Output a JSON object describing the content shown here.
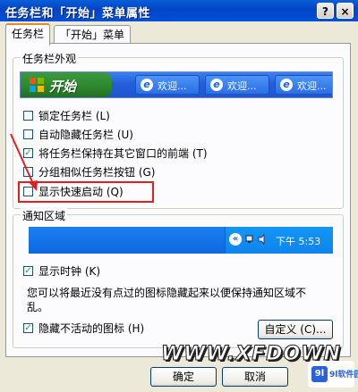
{
  "window": {
    "title": "任务栏和「开始」菜单属性",
    "help_label": "?",
    "close_label": "×"
  },
  "tabs": [
    {
      "label": "任务栏"
    },
    {
      "label": "「开始」菜单"
    }
  ],
  "appearance": {
    "group_label": "任务栏外观",
    "preview": {
      "start_label": "开始",
      "buttons": [
        {
          "label": "欢迎..."
        },
        {
          "label": "欢迎..."
        },
        {
          "label": "欢迎..."
        }
      ]
    },
    "options": [
      {
        "label": "锁定任务栏 (L)",
        "checked": false
      },
      {
        "label": "自动隐藏任务栏 (U)",
        "checked": false
      },
      {
        "label": "将任务栏保持在其它窗口的前端 (T)",
        "checked": true
      },
      {
        "label": "分组相似任务栏按钮 (G)",
        "checked": false
      },
      {
        "label": "显示快速启动 (Q)",
        "checked": false
      }
    ],
    "check_mark": "✓"
  },
  "notification": {
    "group_label": "通知区域",
    "tray_chevron": "«",
    "clock": "下午 5:53",
    "show_clock": {
      "label": "显示时钟 (K)",
      "checked": true
    },
    "description": "您可以将最近没有点过的图标隐藏起来以便保持通知区域不乱。",
    "hide_inactive": {
      "label": "隐藏不活动的图标 (H)",
      "checked": true
    },
    "customize_label": "自定义 (C)..."
  },
  "footer": {
    "ok_label": "确定",
    "cancel_label": "取消"
  },
  "watermark": {
    "text": "WWW.XFDOWN",
    "badge_logo": "9l",
    "badge_text": "9l软件园"
  },
  "colors": {
    "highlight": "#e02020",
    "title_bar": "#0245c6",
    "start_button": "#2f8a2f"
  }
}
